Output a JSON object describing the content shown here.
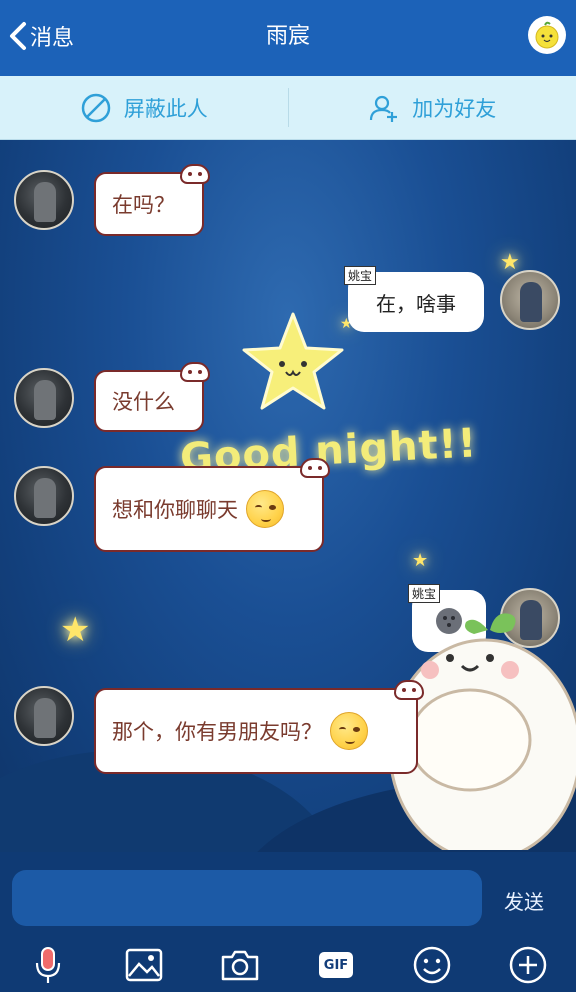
{
  "header": {
    "back_label": "消息",
    "title": "雨宸"
  },
  "actions": {
    "block_label": "屏蔽此人",
    "add_friend_label": "加为好友"
  },
  "background": {
    "text": "Good night!!"
  },
  "messages": [
    {
      "from": "other",
      "text": "在吗？"
    },
    {
      "from": "me",
      "tag": "姚宝",
      "text": "在，啥事"
    },
    {
      "from": "other",
      "text": "没什么"
    },
    {
      "from": "other",
      "text": "想和你聊聊天",
      "emoji": "shy-smile-emoji"
    },
    {
      "from": "me",
      "tag": "姚宝",
      "sticker": "moon-sticker"
    },
    {
      "from": "other",
      "text": "那个，你有男朋友吗？",
      "emoji": "shy-smile-emoji"
    }
  ],
  "input": {
    "value": "",
    "placeholder": "",
    "send_label": "发送"
  },
  "toolbar": {
    "items": [
      "microphone-icon",
      "image-icon",
      "camera-icon",
      "gif-icon",
      "emoji-icon",
      "plus-icon"
    ],
    "gif_label": "GIF"
  },
  "colors": {
    "header_bg": "#1c62b8",
    "action_bar_bg": "#d8f2fa",
    "action_text": "#2fa0d8",
    "bubble_border": "#7a2a2a",
    "bubble_text": "#7a3b2e",
    "input_bg": "#1c5aa6"
  }
}
